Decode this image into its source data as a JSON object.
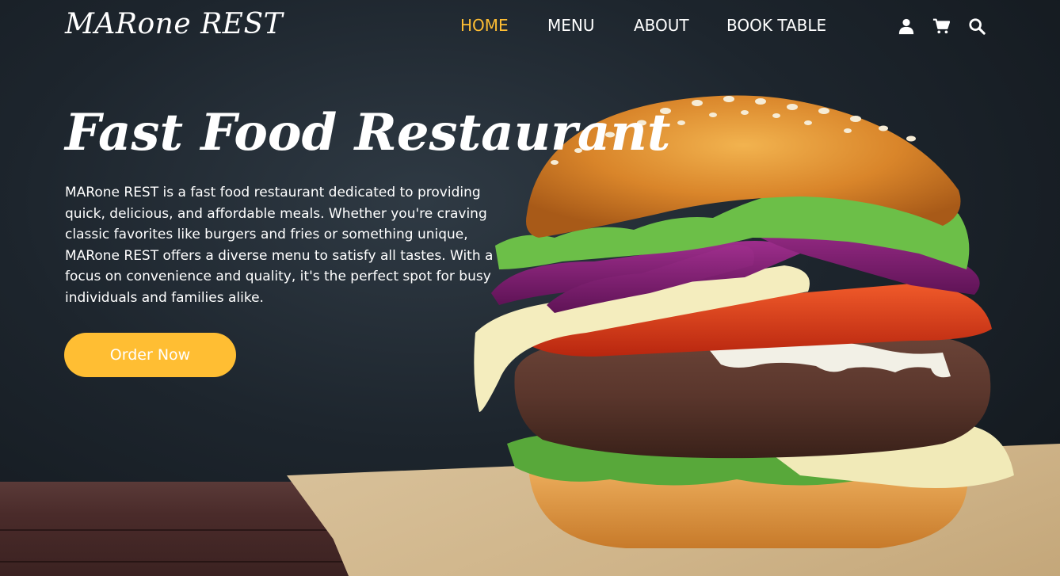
{
  "brand": {
    "logo": "MARone REST"
  },
  "nav": {
    "links": [
      {
        "label": "HOME",
        "active": true
      },
      {
        "label": "MENU",
        "active": false
      },
      {
        "label": "ABOUT",
        "active": false
      },
      {
        "label": "BOOK TABLE",
        "active": false
      }
    ],
    "icons": [
      "user-icon",
      "cart-icon",
      "search-icon"
    ]
  },
  "hero": {
    "title": "Fast Food Restaurant",
    "description": "MARone REST is a fast food restaurant dedicated to providing quick, delicious, and affordable meals. Whether you're craving classic favorites like burgers and fries or something unique, MARone REST offers a diverse menu to satisfy all tastes. With a focus on convenience and quality, it's the perfect spot for busy individuals and families alike.",
    "cta_label": "Order Now",
    "image": "burger-image"
  },
  "colors": {
    "accent": "#ffbe33",
    "text": "#ffffff",
    "background": "#1d252d"
  }
}
